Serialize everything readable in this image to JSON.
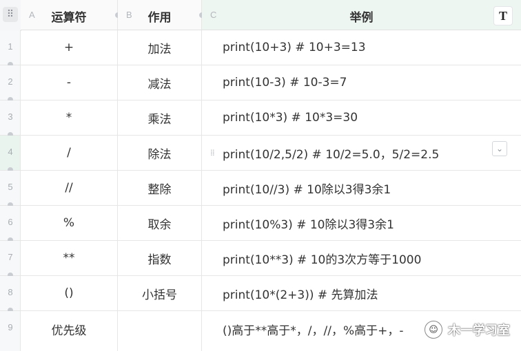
{
  "columns": [
    {
      "letter": "A",
      "title": "运算符"
    },
    {
      "letter": "B",
      "title": "作用"
    },
    {
      "letter": "C",
      "title": "举例"
    }
  ],
  "toolbar": {
    "text_type_icon": "T"
  },
  "rows": [
    {
      "num": "1",
      "op": "+",
      "desc": "加法",
      "example": "print(10+3) # 10+3=13"
    },
    {
      "num": "2",
      "op": "-",
      "desc": "减法",
      "example": "print(10-3) # 10-3=7"
    },
    {
      "num": "3",
      "op": "*",
      "desc": "乘法",
      "example": "print(10*3) # 10*3=30"
    },
    {
      "num": "4",
      "op": "/",
      "desc": "除法",
      "example": "print(10/2,5/2) # 10/2=5.0，5/2=2.5"
    },
    {
      "num": "5",
      "op": "//",
      "desc": "整除",
      "example": "print(10//3) # 10除以3得3余1"
    },
    {
      "num": "6",
      "op": "%",
      "desc": "取余",
      "example": "print(10%3) # 10除以3得3余1"
    },
    {
      "num": "7",
      "op": "**",
      "desc": "指数",
      "example": "print(10**3) # 10的3次方等于1000"
    },
    {
      "num": "8",
      "op": "()",
      "desc": "小括号",
      "example": "print(10*(2+3)) # 先算加法"
    },
    {
      "num": "9",
      "op": "优先级",
      "desc": "",
      "example": "()高于**高于*，/，//，%高于+，-"
    }
  ],
  "watermark": {
    "text": "木一学习室"
  },
  "icons": {
    "grip": "grip-icon",
    "text_type": "text-type-icon",
    "dropdown": "chevron-down-icon",
    "drag": "drag-handle-icon",
    "watermark": "wechat-icon"
  }
}
